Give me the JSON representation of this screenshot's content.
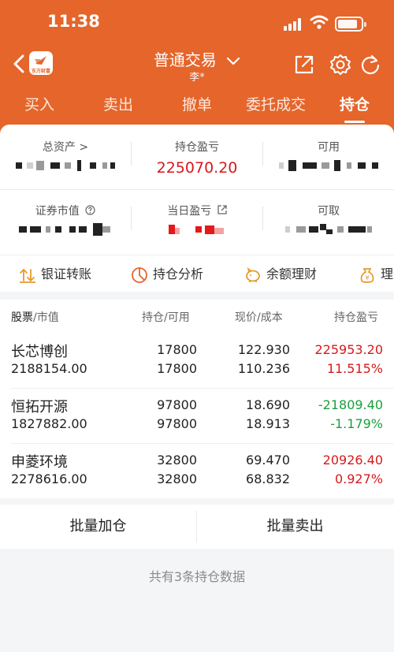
{
  "status": {
    "time": "11:38"
  },
  "header": {
    "title": "普通交易",
    "account": "李*",
    "logo_text": "东方财富"
  },
  "tabs": [
    "买入",
    "卖出",
    "撤单",
    "委托成交",
    "持仓"
  ],
  "summary": {
    "total_assets_label": "总资产 >",
    "position_pl_label": "持仓盈亏",
    "position_pl_value": "225070.20",
    "available_label": "可用",
    "market_value_label": "证券市值",
    "today_pl_label": "当日盈亏",
    "withdrawable_label": "可取"
  },
  "quick": [
    "银证转账",
    "持仓分析",
    "余额理财",
    "理财"
  ],
  "list": {
    "headers": {
      "stock": "股票",
      "market": "市值",
      "hold": "持仓",
      "avail": "可用",
      "price": "现价",
      "cost": "成本",
      "pl": "持仓盈亏"
    },
    "rows": [
      {
        "name": "长芯博创",
        "market_value": "2188154.00",
        "hold": "17800",
        "avail": "17800",
        "price": "122.930",
        "cost": "110.236",
        "pl": "225953.20",
        "pl_pct": "11.515%",
        "trend": "up"
      },
      {
        "name": "恒拓开源",
        "market_value": "1827882.00",
        "hold": "97800",
        "avail": "97800",
        "price": "18.690",
        "cost": "18.913",
        "pl": "-21809.40",
        "pl_pct": "-1.179%",
        "trend": "down"
      },
      {
        "name": "申菱环境",
        "market_value": "2278616.00",
        "hold": "32800",
        "avail": "32800",
        "price": "69.470",
        "cost": "68.832",
        "pl": "20926.40",
        "pl_pct": "0.927%",
        "trend": "up"
      }
    ]
  },
  "actions": {
    "batch_add": "批量加仓",
    "batch_sell": "批量卖出"
  },
  "footer": "共有3条持仓数据",
  "colors": {
    "brand": "#e5652b",
    "up": "#d7191c",
    "down": "#1aa03c"
  }
}
